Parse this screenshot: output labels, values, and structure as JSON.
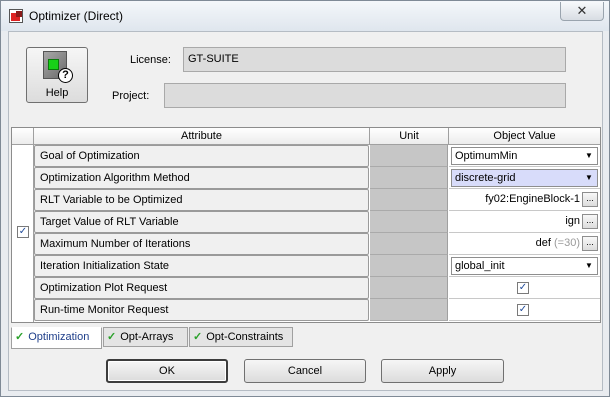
{
  "window": {
    "title": "Optimizer (Direct)",
    "close_glyph": "✕"
  },
  "help": {
    "label": "Help",
    "icon": "help-icon"
  },
  "license": {
    "label": "License:",
    "value": "GT-SUITE"
  },
  "project": {
    "label": "Project:",
    "value": ""
  },
  "table": {
    "columns": [
      "Attribute",
      "Unit",
      "Object Value"
    ],
    "rows": [
      {
        "attribute": "Goal of Optimization",
        "unit": "",
        "value": "OptimumMin",
        "control": "combo"
      },
      {
        "attribute": "Optimization Algorithm Method",
        "unit": "",
        "value": "discrete-grid",
        "control": "combo"
      },
      {
        "attribute": "RLT Variable to be Optimized",
        "unit": "",
        "value": "fy02:EngineBlock-1",
        "control": "text-browse"
      },
      {
        "attribute": "Target Value of RLT Variable",
        "unit": "",
        "value": "ign",
        "control": "text-browse"
      },
      {
        "attribute": "Maximum Number of Iterations",
        "unit": "",
        "value": "def",
        "value_suffix": "(=30)",
        "control": "text-browse"
      },
      {
        "attribute": "Iteration Initialization State",
        "unit": "",
        "value": "global_init",
        "control": "combo"
      },
      {
        "attribute": "Optimization Plot Request",
        "unit": "",
        "value": true,
        "control": "checkbox"
      },
      {
        "attribute": "Run-time Monitor Request",
        "unit": "",
        "value": true,
        "control": "checkbox"
      }
    ],
    "gutter_checked": true
  },
  "tabs": [
    {
      "label": "Optimization",
      "active": true
    },
    {
      "label": "Opt-Arrays",
      "active": false
    },
    {
      "label": "Opt-Constraints",
      "active": false
    }
  ],
  "buttons": {
    "ok": "OK",
    "cancel": "Cancel",
    "apply": "Apply"
  },
  "glyphs": {
    "dropdown": "▼",
    "browse": "...",
    "check": "✓"
  }
}
